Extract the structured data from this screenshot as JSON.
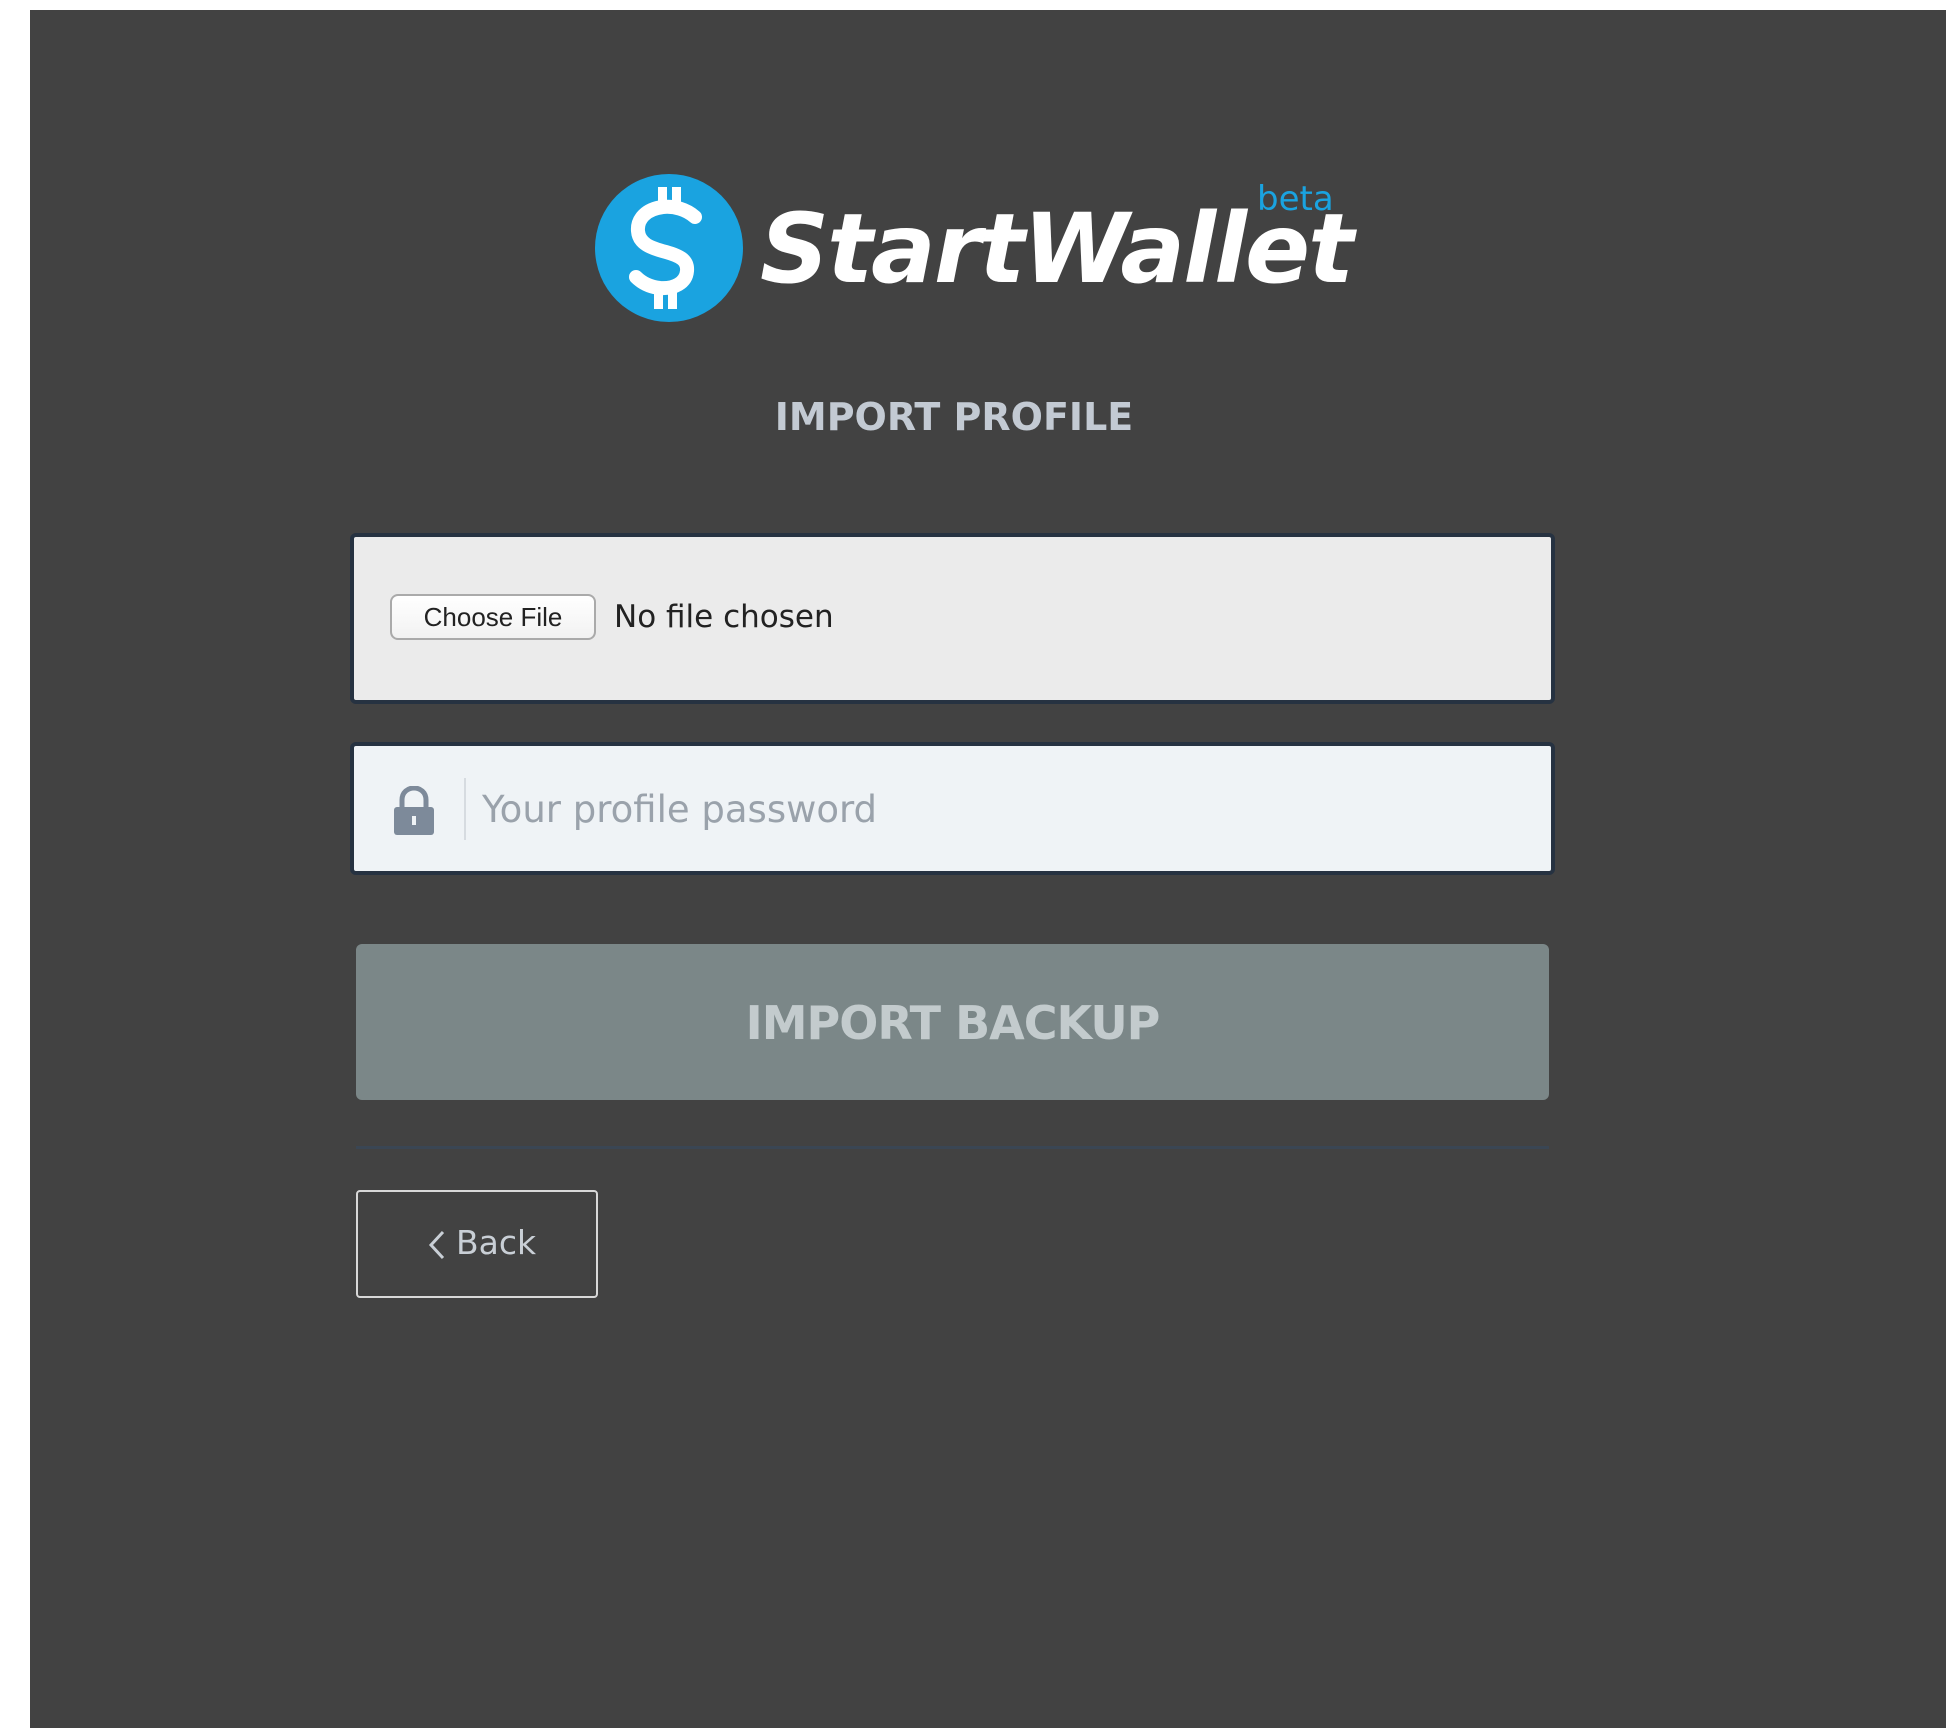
{
  "brand": {
    "name": "StartWallet",
    "badge": "beta",
    "coin_symbol": "$",
    "accent_color": "#1aa3e0",
    "icon": "dollar-coin-icon"
  },
  "page": {
    "title": "IMPORT PROFILE",
    "background_color": "#424242"
  },
  "file_input": {
    "button_label": "Choose File",
    "status": "No file chosen"
  },
  "password": {
    "icon": "lock-icon",
    "placeholder": "Your profile password",
    "value": ""
  },
  "actions": {
    "import_label": "IMPORT BACKUP",
    "import_color": "#7b8788",
    "back_label": "Back",
    "back_icon": "chevron-left-icon"
  }
}
